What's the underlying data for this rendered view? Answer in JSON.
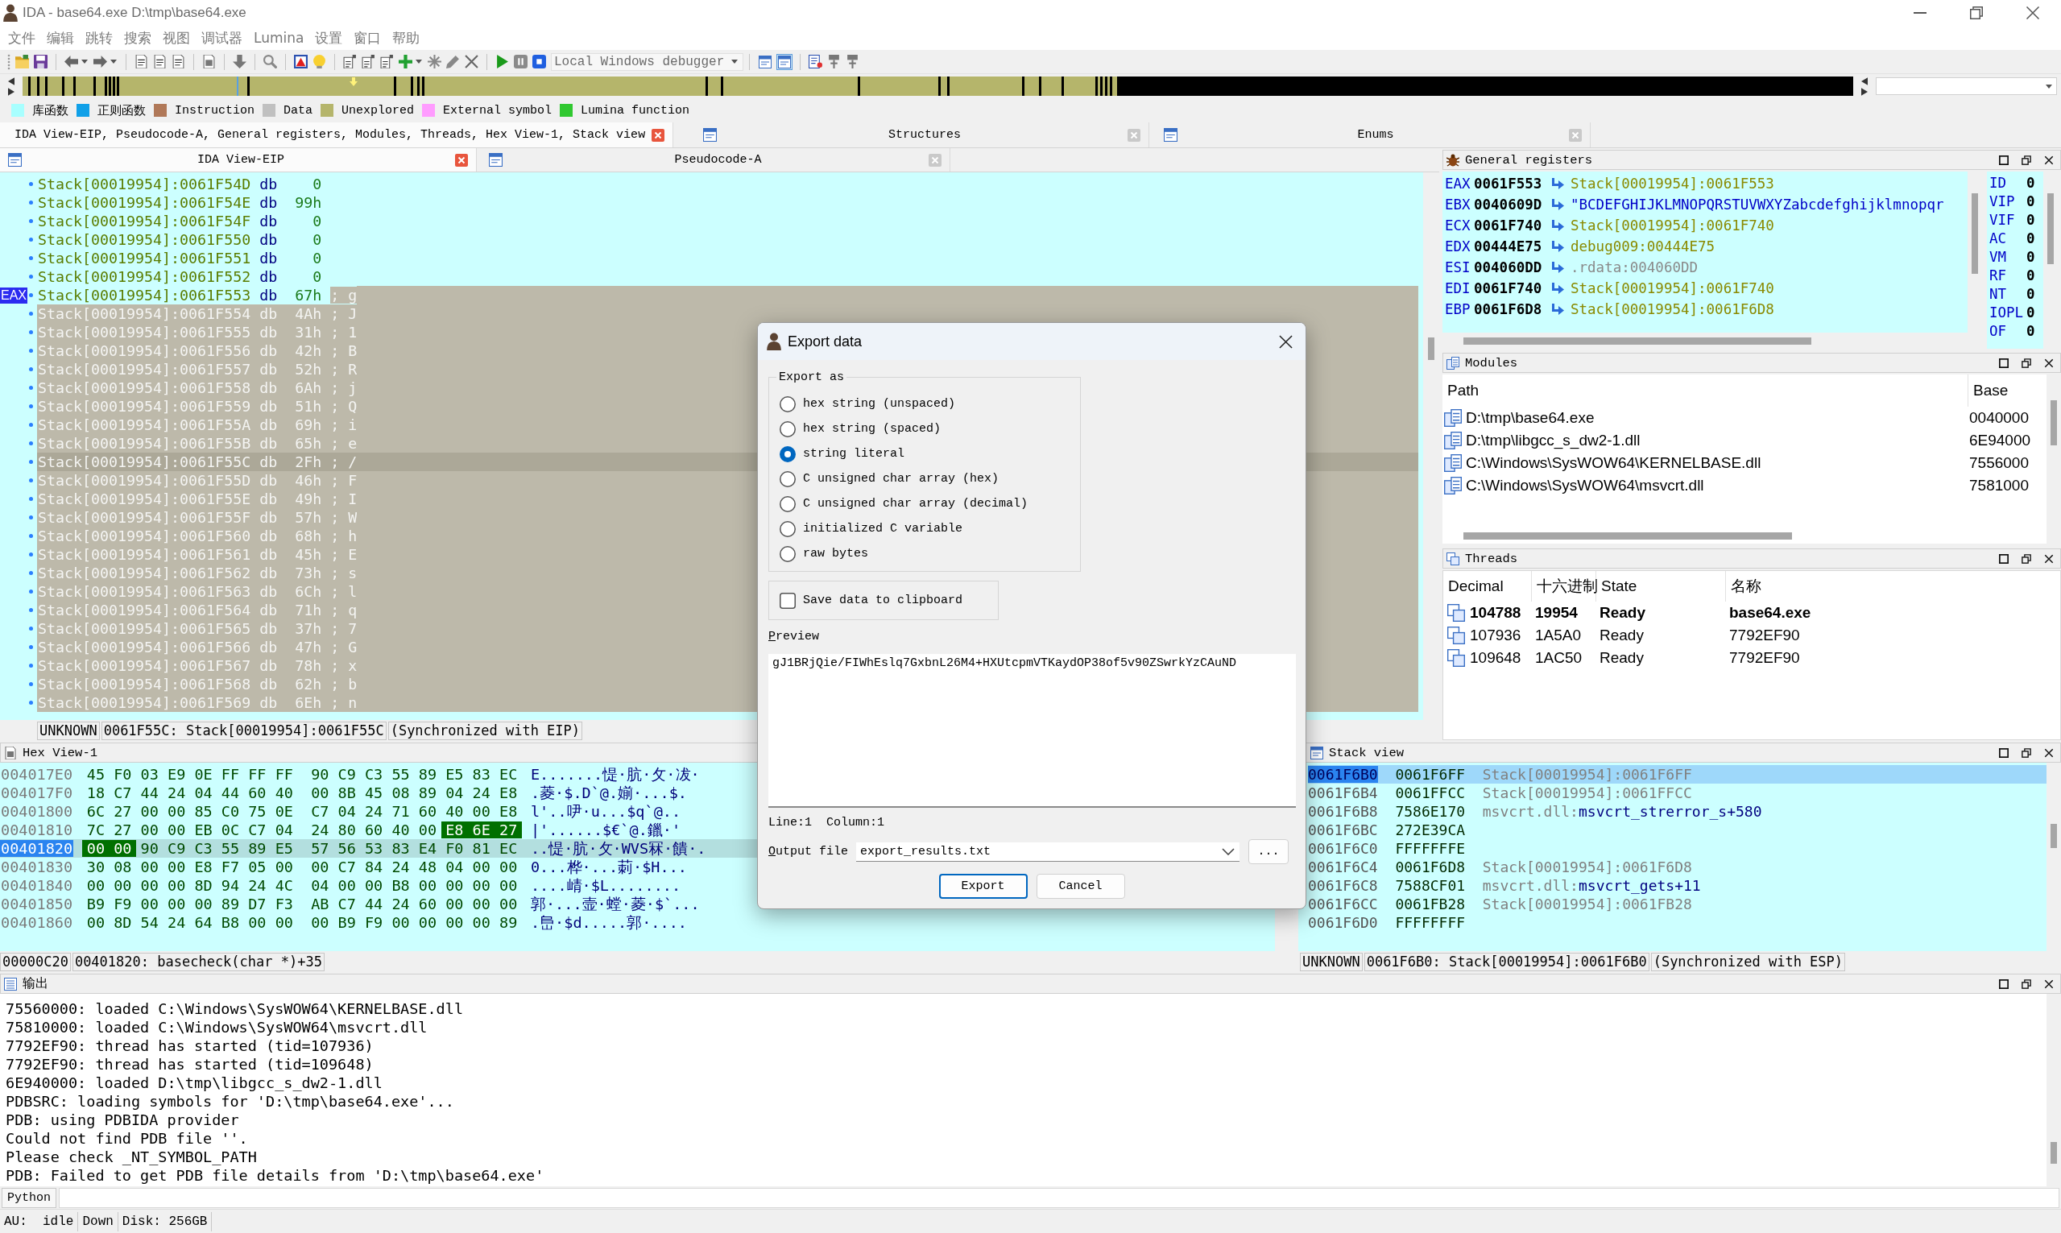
{
  "window": {
    "title": "IDA - base64.exe D:\\tmp\\base64.exe"
  },
  "menu": [
    {
      "label": "文件",
      "disabled": true
    },
    {
      "label": "编辑",
      "disabled": true
    },
    {
      "label": "跳转",
      "disabled": true
    },
    {
      "label": "搜索",
      "disabled": true
    },
    {
      "label": "视图",
      "disabled": true
    },
    {
      "label": "调试器",
      "disabled": true
    },
    {
      "label": "Lumina",
      "disabled": true
    },
    {
      "label": "设置",
      "disabled": true
    },
    {
      "label": "窗口",
      "disabled": true
    },
    {
      "label": "帮助",
      "disabled": true
    }
  ],
  "toolbar": {
    "debugger": "Local Windows debugger",
    "toggles": [
      {
        "selected": false
      },
      {
        "selected": true
      }
    ]
  },
  "legend": [
    {
      "label": "库函数",
      "color": "#a8ffff"
    },
    {
      "label": "正则函数",
      "color": "#10a0e8"
    },
    {
      "label": "Instruction",
      "color": "#b07858"
    },
    {
      "label": "Data",
      "color": "#c0c0c0"
    },
    {
      "label": "Unexplored",
      "color": "#b5b56b"
    },
    {
      "label": "External symbol",
      "color": "#ff9cff"
    },
    {
      "label": "Lumina function",
      "color": "#30c830"
    }
  ],
  "dock_tabs": [
    {
      "label": "IDA View-EIP, Pseudocode-A, General registers, Modules, Threads, Hex View-1, Stack view",
      "selected": true
    },
    {
      "label": "Structures",
      "selected": false
    },
    {
      "label": "Enums",
      "selected": false
    }
  ],
  "ida_view": {
    "tabs": [
      {
        "label": "IDA View-EIP",
        "selected": true
      },
      {
        "label": "Pseudocode-A",
        "selected": false
      }
    ],
    "rows": [
      {
        "address": "Stack[00019954]:0061F54D",
        "op": "db",
        "value": "0",
        "selected": false,
        "tail_selected": false,
        "current": false
      },
      {
        "address": "Stack[00019954]:0061F54E",
        "op": "db",
        "value": "99h",
        "selected": false,
        "tail_selected": false,
        "current": false
      },
      {
        "address": "Stack[00019954]:0061F54F",
        "op": "db",
        "value": "0",
        "selected": false,
        "tail_selected": false,
        "current": false
      },
      {
        "address": "Stack[00019954]:0061F550",
        "op": "db",
        "value": "0",
        "selected": false,
        "tail_selected": false,
        "current": false
      },
      {
        "address": "Stack[00019954]:0061F551",
        "op": "db",
        "value": "0",
        "selected": false,
        "tail_selected": false,
        "current": false
      },
      {
        "address": "Stack[00019954]:0061F552",
        "op": "db",
        "value": "0",
        "selected": false,
        "tail_selected": false,
        "current": false
      },
      {
        "address": "Stack[00019954]:0061F553",
        "op": "db",
        "value": "67h",
        "comment": "; g",
        "marker": "EAX",
        "selected": false,
        "tail_selected": true,
        "current": false
      },
      {
        "address": "Stack[00019954]:0061F554",
        "op": "db",
        "value": "4Ah",
        "comment": "; J",
        "selected": true,
        "tail_selected": true,
        "current": false
      },
      {
        "address": "Stack[00019954]:0061F555",
        "op": "db",
        "value": "31h",
        "comment": "; 1",
        "selected": true,
        "tail_selected": true,
        "current": false
      },
      {
        "address": "Stack[00019954]:0061F556",
        "op": "db",
        "value": "42h",
        "comment": "; B",
        "selected": true,
        "tail_selected": true,
        "current": false
      },
      {
        "address": "Stack[00019954]:0061F557",
        "op": "db",
        "value": "52h",
        "comment": "; R",
        "selected": true,
        "tail_selected": true,
        "current": false
      },
      {
        "address": "Stack[00019954]:0061F558",
        "op": "db",
        "value": "6Ah",
        "comment": "; j",
        "selected": true,
        "tail_selected": true,
        "current": false
      },
      {
        "address": "Stack[00019954]:0061F559",
        "op": "db",
        "value": "51h",
        "comment": "; Q",
        "selected": true,
        "tail_selected": true,
        "current": false
      },
      {
        "address": "Stack[00019954]:0061F55A",
        "op": "db",
        "value": "69h",
        "comment": "; i",
        "selected": true,
        "tail_selected": true,
        "current": false
      },
      {
        "address": "Stack[00019954]:0061F55B",
        "op": "db",
        "value": "65h",
        "comment": "; e",
        "selected": true,
        "tail_selected": true,
        "current": false
      },
      {
        "address": "Stack[00019954]:0061F55C",
        "op": "db",
        "value": "2Fh",
        "comment": "; /",
        "selected": true,
        "tail_selected": true,
        "current": true
      },
      {
        "address": "Stack[00019954]:0061F55D",
        "op": "db",
        "value": "46h",
        "comment": "; F",
        "selected": true,
        "tail_selected": true,
        "current": false
      },
      {
        "address": "Stack[00019954]:0061F55E",
        "op": "db",
        "value": "49h",
        "comment": "; I",
        "selected": true,
        "tail_selected": true,
        "current": false
      },
      {
        "address": "Stack[00019954]:0061F55F",
        "op": "db",
        "value": "57h",
        "comment": "; W",
        "selected": true,
        "tail_selected": true,
        "current": false
      },
      {
        "address": "Stack[00019954]:0061F560",
        "op": "db",
        "value": "68h",
        "comment": "; h",
        "selected": true,
        "tail_selected": true,
        "current": false
      },
      {
        "address": "Stack[00019954]:0061F561",
        "op": "db",
        "value": "45h",
        "comment": "; E",
        "selected": true,
        "tail_selected": true,
        "current": false
      },
      {
        "address": "Stack[00019954]:0061F562",
        "op": "db",
        "value": "73h",
        "comment": "; s",
        "selected": true,
        "tail_selected": true,
        "current": false
      },
      {
        "address": "Stack[00019954]:0061F563",
        "op": "db",
        "value": "6Ch",
        "comment": "; l",
        "selected": true,
        "tail_selected": true,
        "current": false
      },
      {
        "address": "Stack[00019954]:0061F564",
        "op": "db",
        "value": "71h",
        "comment": "; q",
        "selected": true,
        "tail_selected": true,
        "current": false
      },
      {
        "address": "Stack[00019954]:0061F565",
        "op": "db",
        "value": "37h",
        "comment": "; 7",
        "selected": true,
        "tail_selected": true,
        "current": false
      },
      {
        "address": "Stack[00019954]:0061F566",
        "op": "db",
        "value": "47h",
        "comment": "; G",
        "selected": true,
        "tail_selected": true,
        "current": false
      },
      {
        "address": "Stack[00019954]:0061F567",
        "op": "db",
        "value": "78h",
        "comment": "; x",
        "selected": true,
        "tail_selected": true,
        "current": false
      },
      {
        "address": "Stack[00019954]:0061F568",
        "op": "db",
        "value": "62h",
        "comment": "; b",
        "selected": true,
        "tail_selected": true,
        "current": false
      },
      {
        "address": "Stack[00019954]:0061F569",
        "op": "db",
        "value": "6Eh",
        "comment": "; n",
        "selected": true,
        "tail_selected": true,
        "current": false
      }
    ],
    "status": [
      "UNKNOWN",
      "0061F55C: Stack[00019954]:0061F55C",
      "(Synchronized with EIP)"
    ]
  },
  "registers": {
    "title": "General registers",
    "rows": [
      {
        "name": "EAX",
        "value": "0061F553",
        "target": "Stack[00019954]:0061F553",
        "kind": "pointer"
      },
      {
        "name": "EBX",
        "value": "0040609D",
        "target": "\"BCDEFGHIJKLMNOPQRSTUVWXYZabcdefghijklmnopqr",
        "kind": "string"
      },
      {
        "name": "ECX",
        "value": "0061F740",
        "target": "Stack[00019954]:0061F740",
        "kind": "pointer"
      },
      {
        "name": "EDX",
        "value": "00444E75",
        "target": "debug009:00444E75",
        "kind": "pointer"
      },
      {
        "name": "ESI",
        "value": "004060DD",
        "target": ".rdata:004060DD",
        "kind": "readonly"
      },
      {
        "name": "EDI",
        "value": "0061F740",
        "target": "Stack[00019954]:0061F740",
        "kind": "pointer"
      },
      {
        "name": "EBP",
        "value": "0061F6D8",
        "target": "Stack[00019954]:0061F6D8",
        "kind": "pointer"
      }
    ],
    "flags": [
      {
        "name": "ID",
        "value": "0"
      },
      {
        "name": "VIP",
        "value": "0"
      },
      {
        "name": "VIF",
        "value": "0"
      },
      {
        "name": "AC",
        "value": "0"
      },
      {
        "name": "VM",
        "value": "0"
      },
      {
        "name": "RF",
        "value": "0"
      },
      {
        "name": "NT",
        "value": "0"
      },
      {
        "name": "IOPL",
        "value": "0"
      },
      {
        "name": "OF",
        "value": "0"
      }
    ]
  },
  "modules": {
    "title": "Modules",
    "columns": [
      "Path",
      "Base"
    ],
    "rows": [
      {
        "path": "D:\\tmp\\base64.exe",
        "base": "0040000"
      },
      {
        "path": "D:\\tmp\\libgcc_s_dw2-1.dll",
        "base": "6E94000"
      },
      {
        "path": "C:\\Windows\\SysWOW64\\KERNELBASE.dll",
        "base": "7556000"
      },
      {
        "path": "C:\\Windows\\SysWOW64\\msvcrt.dll",
        "base": "7581000"
      }
    ]
  },
  "threads": {
    "title": "Threads",
    "columns": [
      "Decimal",
      "十六进制",
      "State",
      "名称"
    ],
    "rows": [
      {
        "decimal": "104788",
        "hex": "19954",
        "state": "Ready",
        "name": "base64.exe",
        "current": true
      },
      {
        "decimal": "107936",
        "hex": "1A5A0",
        "state": "Ready",
        "name": "7792EF90",
        "current": false
      },
      {
        "decimal": "109648",
        "hex": "1AC50",
        "state": "Ready",
        "name": "7792EF90",
        "current": false
      }
    ]
  },
  "hex_view": {
    "title": "Hex View-1",
    "rows": [
      {
        "address": "004017E0",
        "current": false,
        "ascii": "E.......惿·肮·攵·冹·",
        "bytes": [
          {
            "text": "45",
            "selected": false
          },
          {
            "text": "F0",
            "selected": false
          },
          {
            "text": "03",
            "selected": false
          },
          {
            "text": "E9",
            "selected": false
          },
          {
            "text": "0E",
            "selected": false
          },
          {
            "text": "FF",
            "selected": false
          },
          {
            "text": "FF",
            "selected": false
          },
          {
            "text": "FF",
            "selected": false
          },
          {
            "text": "90",
            "selected": false
          },
          {
            "text": "C9",
            "selected": false
          },
          {
            "text": "C3",
            "selected": false
          },
          {
            "text": "55",
            "selected": false
          },
          {
            "text": "89",
            "selected": false
          },
          {
            "text": "E5",
            "selected": false
          },
          {
            "text": "83",
            "selected": false
          },
          {
            "text": "EC",
            "selected": false
          }
        ]
      },
      {
        "address": "004017F0",
        "current": false,
        "ascii": ".菱·$.D`@.媊·...$.",
        "bytes": [
          {
            "text": "18",
            "selected": false
          },
          {
            "text": "C7",
            "selected": false
          },
          {
            "text": "44",
            "selected": false
          },
          {
            "text": "24",
            "selected": false
          },
          {
            "text": "04",
            "selected": false
          },
          {
            "text": "44",
            "selected": false
          },
          {
            "text": "60",
            "selected": false
          },
          {
            "text": "40",
            "selected": false
          },
          {
            "text": "00",
            "selected": false
          },
          {
            "text": "8B",
            "selected": false
          },
          {
            "text": "45",
            "selected": false
          },
          {
            "text": "08",
            "selected": false
          },
          {
            "text": "89",
            "selected": false
          },
          {
            "text": "04",
            "selected": false
          },
          {
            "text": "24",
            "selected": false
          },
          {
            "text": "E8",
            "selected": false
          }
        ]
      },
      {
        "address": "00401800",
        "current": false,
        "ascii": "l'..吚·u...$q`@..",
        "bytes": [
          {
            "text": "6C",
            "selected": false
          },
          {
            "text": "27",
            "selected": false
          },
          {
            "text": "00",
            "selected": false
          },
          {
            "text": "00",
            "selected": false
          },
          {
            "text": "85",
            "selected": false
          },
          {
            "text": "C0",
            "selected": false
          },
          {
            "text": "75",
            "selected": false
          },
          {
            "text": "0E",
            "selected": false
          },
          {
            "text": "C7",
            "selected": false
          },
          {
            "text": "04",
            "selected": false
          },
          {
            "text": "24",
            "selected": false
          },
          {
            "text": "71",
            "selected": false
          },
          {
            "text": "60",
            "selected": false
          },
          {
            "text": "40",
            "selected": false
          },
          {
            "text": "00",
            "selected": false
          },
          {
            "text": "E8",
            "selected": false
          }
        ]
      },
      {
        "address": "00401810",
        "current": false,
        "ascii": "|'......$€`@.鑞·'",
        "bytes": [
          {
            "text": "7C",
            "selected": false
          },
          {
            "text": "27",
            "selected": false
          },
          {
            "text": "00",
            "selected": false
          },
          {
            "text": "00",
            "selected": false
          },
          {
            "text": "EB",
            "selected": false
          },
          {
            "text": "0C",
            "selected": false
          },
          {
            "text": "C7",
            "selected": false
          },
          {
            "text": "04",
            "selected": false
          },
          {
            "text": "24",
            "selected": false
          },
          {
            "text": "80",
            "selected": false
          },
          {
            "text": "60",
            "selected": false
          },
          {
            "text": "40",
            "selected": false
          },
          {
            "text": "00",
            "selected": false
          },
          {
            "text": "E8",
            "selected": true
          },
          {
            "text": "6E",
            "selected": true
          },
          {
            "text": "27",
            "selected": true
          }
        ]
      },
      {
        "address": "00401820",
        "current": true,
        "ascii": "..惿·肮·攵·WVS冧·饋·.",
        "bytes": [
          {
            "text": "00",
            "selected": true
          },
          {
            "text": "00",
            "selected": true
          },
          {
            "text": "90",
            "selected": false
          },
          {
            "text": "C9",
            "selected": false
          },
          {
            "text": "C3",
            "selected": false
          },
          {
            "text": "55",
            "selected": false
          },
          {
            "text": "89",
            "selected": false
          },
          {
            "text": "E5",
            "selected": false
          },
          {
            "text": "57",
            "selected": false
          },
          {
            "text": "56",
            "selected": false
          },
          {
            "text": "53",
            "selected": false
          },
          {
            "text": "83",
            "selected": false
          },
          {
            "text": "E4",
            "selected": false
          },
          {
            "text": "F0",
            "selected": false
          },
          {
            "text": "81",
            "selected": false
          },
          {
            "text": "EC",
            "selected": false
          }
        ]
      },
      {
        "address": "00401830",
        "current": false,
        "ascii": "0...桦·...莿·$H...",
        "bytes": [
          {
            "text": "30",
            "selected": false
          },
          {
            "text": "08",
            "selected": false
          },
          {
            "text": "00",
            "selected": false
          },
          {
            "text": "00",
            "selected": false
          },
          {
            "text": "E8",
            "selected": false
          },
          {
            "text": "F7",
            "selected": false
          },
          {
            "text": "05",
            "selected": false
          },
          {
            "text": "00",
            "selected": false
          },
          {
            "text": "00",
            "selected": false
          },
          {
            "text": "C7",
            "selected": false
          },
          {
            "text": "84",
            "selected": false
          },
          {
            "text": "24",
            "selected": false
          },
          {
            "text": "48",
            "selected": false
          },
          {
            "text": "04",
            "selected": false
          },
          {
            "text": "00",
            "selected": false
          },
          {
            "text": "00",
            "selected": false
          }
        ]
      },
      {
        "address": "00401840",
        "current": false,
        "ascii": "....崝·$L........",
        "bytes": [
          {
            "text": "00",
            "selected": false
          },
          {
            "text": "00",
            "selected": false
          },
          {
            "text": "00",
            "selected": false
          },
          {
            "text": "00",
            "selected": false
          },
          {
            "text": "8D",
            "selected": false
          },
          {
            "text": "94",
            "selected": false
          },
          {
            "text": "24",
            "selected": false
          },
          {
            "text": "4C",
            "selected": false
          },
          {
            "text": "04",
            "selected": false
          },
          {
            "text": "00",
            "selected": false
          },
          {
            "text": "00",
            "selected": false
          },
          {
            "text": "B8",
            "selected": false
          },
          {
            "text": "00",
            "selected": false
          },
          {
            "text": "00",
            "selected": false
          },
          {
            "text": "00",
            "selected": false
          },
          {
            "text": "00",
            "selected": false
          }
        ]
      },
      {
        "address": "00401850",
        "current": false,
        "ascii": "郭·...壸·螳·菱·$`...",
        "bytes": [
          {
            "text": "B9",
            "selected": false
          },
          {
            "text": "F9",
            "selected": false
          },
          {
            "text": "00",
            "selected": false
          },
          {
            "text": "00",
            "selected": false
          },
          {
            "text": "00",
            "selected": false
          },
          {
            "text": "89",
            "selected": false
          },
          {
            "text": "D7",
            "selected": false
          },
          {
            "text": "F3",
            "selected": false
          },
          {
            "text": "AB",
            "selected": false
          },
          {
            "text": "C7",
            "selected": false
          },
          {
            "text": "44",
            "selected": false
          },
          {
            "text": "24",
            "selected": false
          },
          {
            "text": "60",
            "selected": false
          },
          {
            "text": "00",
            "selected": false
          },
          {
            "text": "00",
            "selected": false
          },
          {
            "text": "00",
            "selected": false
          }
        ]
      },
      {
        "address": "00401860",
        "current": false,
        "ascii": ".峊·$d.....郭·....",
        "bytes": [
          {
            "text": "00",
            "selected": false
          },
          {
            "text": "8D",
            "selected": false
          },
          {
            "text": "54",
            "selected": false
          },
          {
            "text": "24",
            "selected": false
          },
          {
            "text": "64",
            "selected": false
          },
          {
            "text": "B8",
            "selected": false
          },
          {
            "text": "00",
            "selected": false
          },
          {
            "text": "00",
            "selected": false
          },
          {
            "text": "00",
            "selected": false
          },
          {
            "text": "B9",
            "selected": false
          },
          {
            "text": "F9",
            "selected": false
          },
          {
            "text": "00",
            "selected": false
          },
          {
            "text": "00",
            "selected": false
          },
          {
            "text": "00",
            "selected": false
          },
          {
            "text": "00",
            "selected": false
          },
          {
            "text": "89",
            "selected": false
          }
        ]
      }
    ],
    "status": [
      "00000C20",
      "00401820: basecheck(char *)+35"
    ]
  },
  "stack_view": {
    "title": "Stack view",
    "rows": [
      {
        "address": "0061F6B0",
        "value": "0061F6FF",
        "location": "Stack[00019954]:0061F6FF",
        "current": true
      },
      {
        "address": "0061F6B4",
        "value": "0061FFCC",
        "location": "Stack[00019954]:0061FFCC",
        "current": false
      },
      {
        "address": "0061F6B8",
        "value": "7586E170",
        "location": "msvcrt.dll:",
        "symbol": "msvcrt_strerror_s+580",
        "current": false
      },
      {
        "address": "0061F6BC",
        "value": "272E39CA",
        "current": false
      },
      {
        "address": "0061F6C0",
        "value": "FFFFFFFE",
        "current": false
      },
      {
        "address": "0061F6C4",
        "value": "0061F6D8",
        "location": "Stack[00019954]:0061F6D8",
        "current": false
      },
      {
        "address": "0061F6C8",
        "value": "7588CF01",
        "location": "msvcrt.dll:",
        "symbol": "msvcrt_gets+11",
        "current": false
      },
      {
        "address": "0061F6CC",
        "value": "0061FB28",
        "location": "Stack[00019954]:0061FB28",
        "current": false
      },
      {
        "address": "0061F6D0",
        "value": "FFFFFFFF",
        "current": false
      }
    ],
    "status": [
      "UNKNOWN",
      "0061F6B0: Stack[00019954]:0061F6B0",
      "(Synchronized with ESP)"
    ]
  },
  "output": {
    "title": "输出",
    "lines": [
      "75560000: loaded C:\\Windows\\SysWOW64\\KERNELBASE.dll",
      "75810000: loaded C:\\Windows\\SysWOW64\\msvcrt.dll",
      "7792EF90: thread has started (tid=107936)",
      "7792EF90: thread has started (tid=109648)",
      "6E940000: loaded D:\\tmp\\libgcc_s_dw2-1.dll",
      "PDBSRC: loading symbols for 'D:\\tmp\\base64.exe'...",
      "PDB: using PDBIDA provider",
      "Could not find PDB file ''.",
      "Please check _NT_SYMBOL_PATH",
      "PDB: Failed to get PDB file details from 'D:\\tmp\\base64.exe'"
    ]
  },
  "python": {
    "button": "Python"
  },
  "status_bar": [
    "AU:  idle",
    "Down",
    "Disk: 256GB"
  ],
  "export_dialog": {
    "title": "Export data",
    "group_label": "Export as",
    "options": [
      {
        "label": "hex string (unspaced)",
        "selected": false
      },
      {
        "label": "hex string (spaced)",
        "selected": false
      },
      {
        "label": "string literal",
        "selected": true
      },
      {
        "label": "C unsigned char array (hex)",
        "selected": false
      },
      {
        "label": "C unsigned char array (decimal)",
        "selected": false
      },
      {
        "label": "initialized C variable",
        "selected": false
      },
      {
        "label": "raw bytes",
        "selected": false
      }
    ],
    "clipboard": {
      "label": "Save data to clipboard",
      "checked": false
    },
    "preview_label": "Preview",
    "preview": "gJ1BRjQie/FIWhEslq7GxbnL26M4+HXUtcpmVTKaydOP38of5v90ZSwrkYzCAuND",
    "line": "Line:1",
    "column": "Column:1",
    "output_label": "Output file",
    "output_file": "export_results.txt",
    "browse": "...",
    "buttons": [
      {
        "label": "Export",
        "default": true
      },
      {
        "label": "Cancel",
        "default": false
      }
    ]
  }
}
